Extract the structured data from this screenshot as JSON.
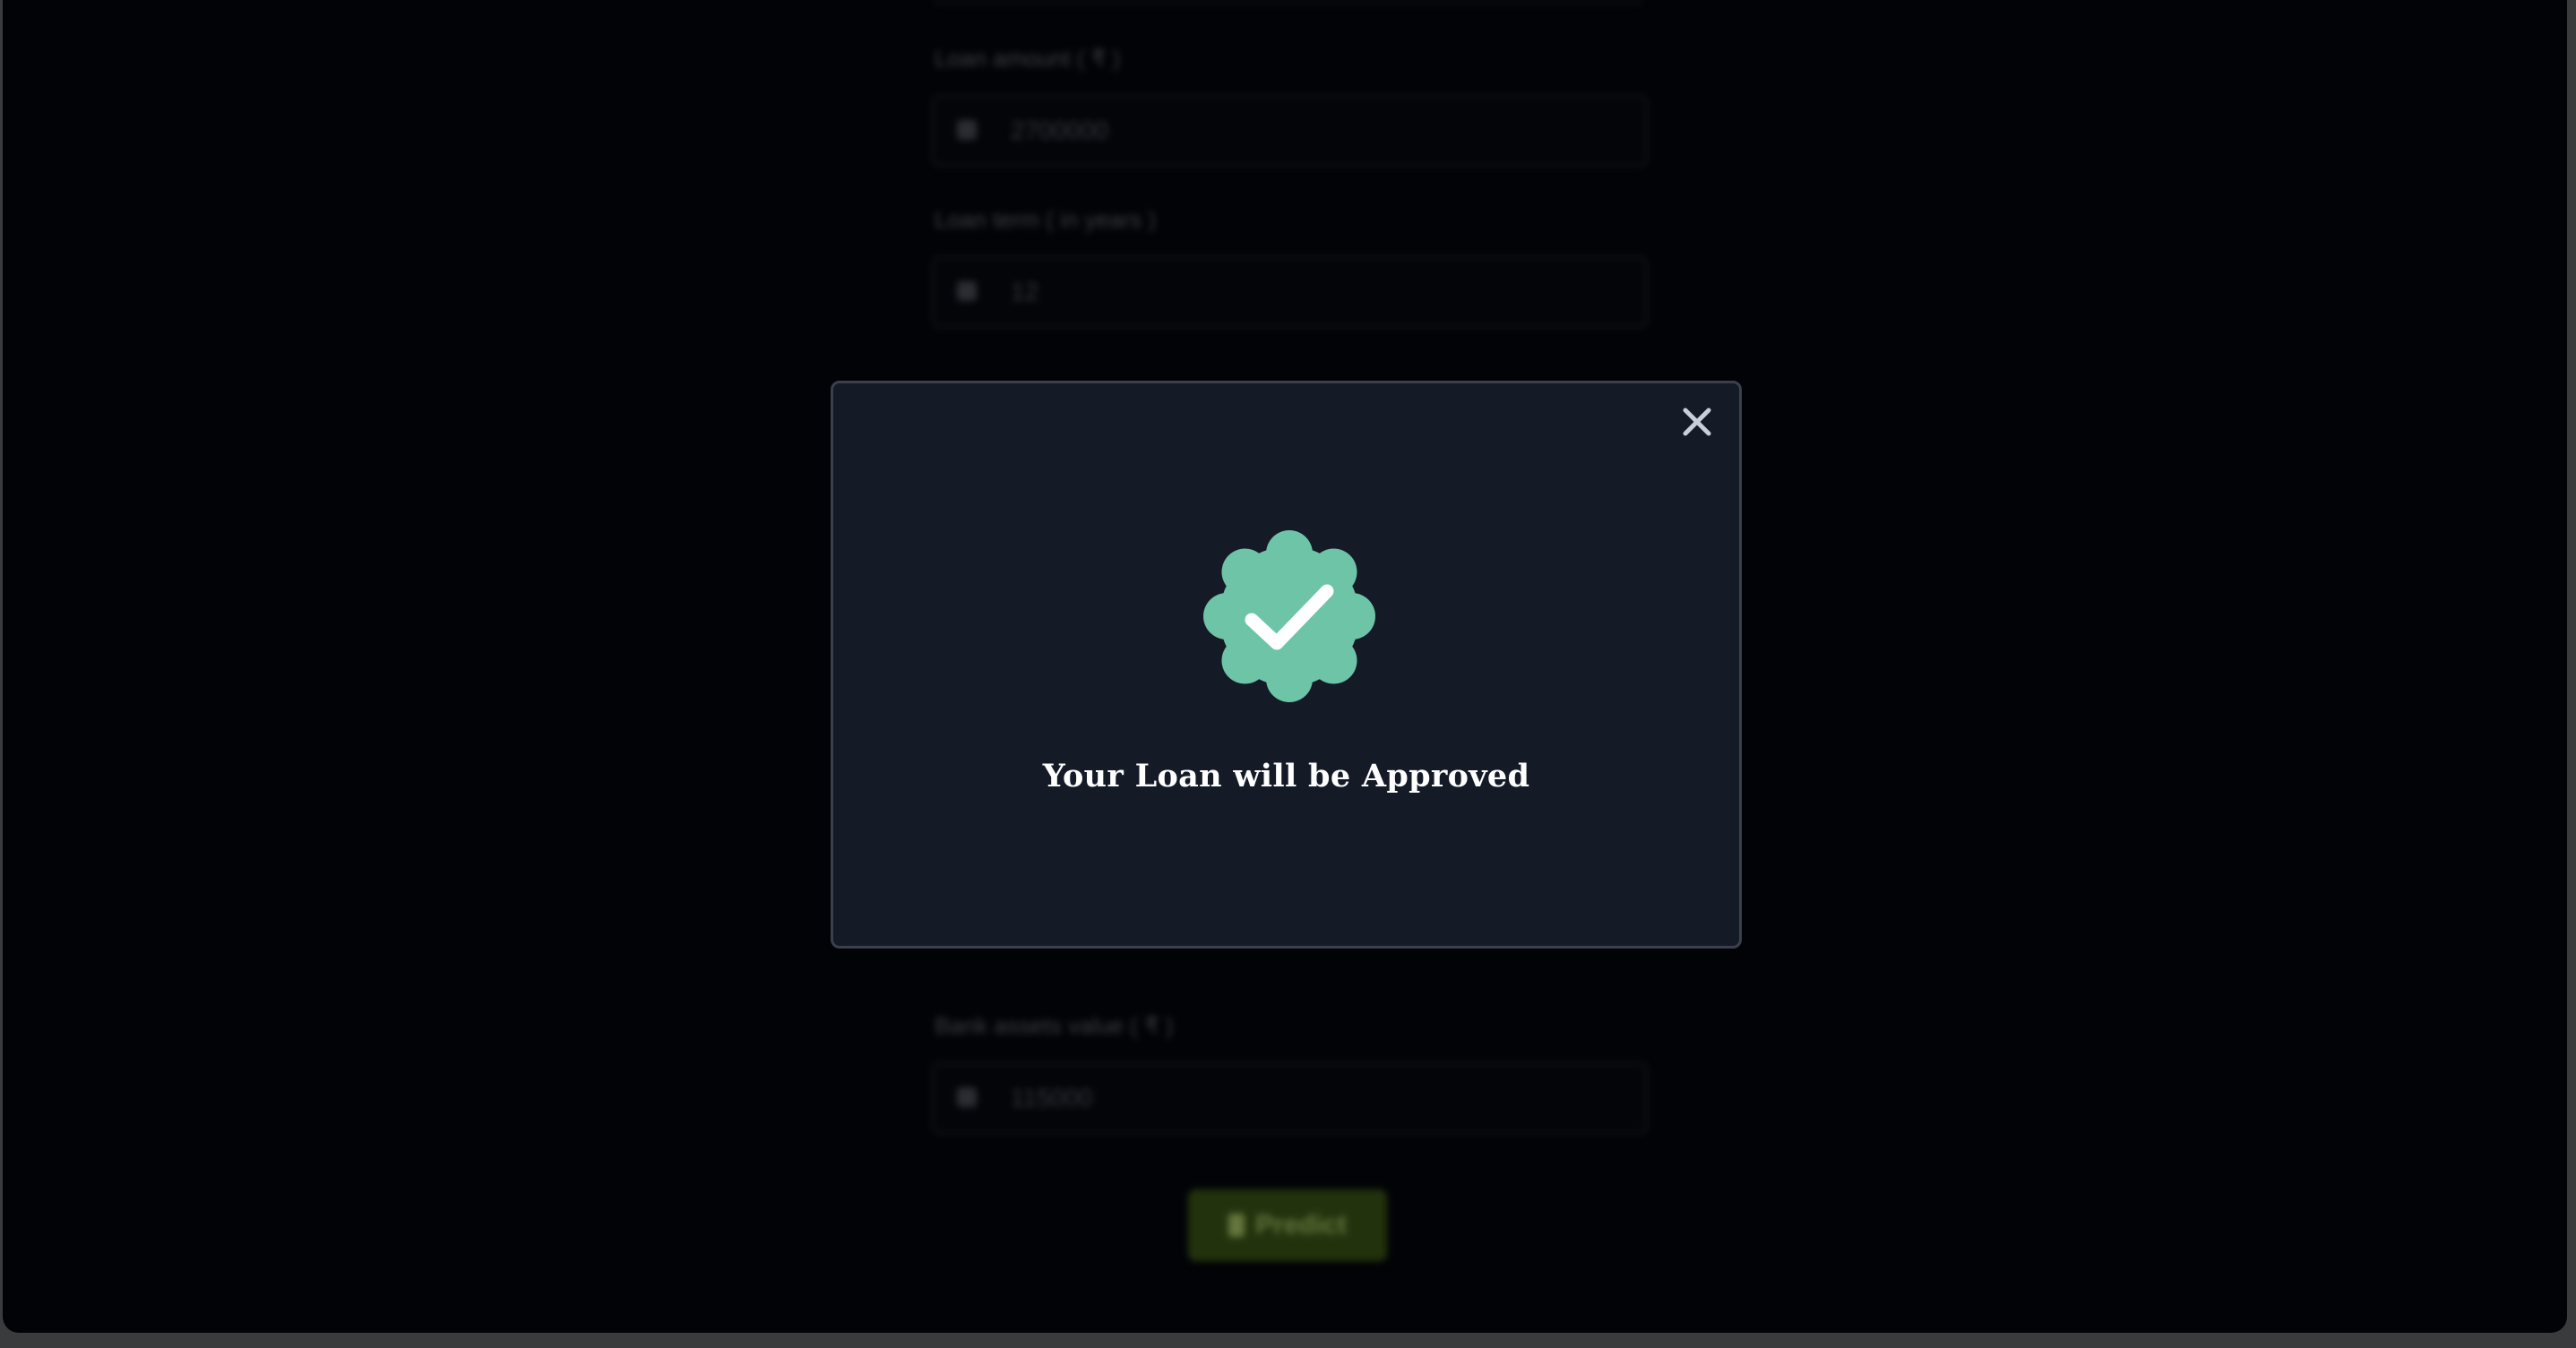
{
  "background_form": {
    "fields": [
      {
        "label": "Loan amount ( ₹ )",
        "value": "2700000"
      },
      {
        "label": "Loan term ( in years )",
        "value": "12"
      },
      {
        "label": "Bank assets value ( ₹ )",
        "value": "115000"
      }
    ],
    "predict_button_label": "Predict"
  },
  "modal": {
    "title": "Your Loan will be Approved",
    "badge_icon": "verified-check-badge-icon",
    "close_icon": "close-icon",
    "badge_color": "#6ec4a6",
    "panel_color": "#151a27"
  }
}
